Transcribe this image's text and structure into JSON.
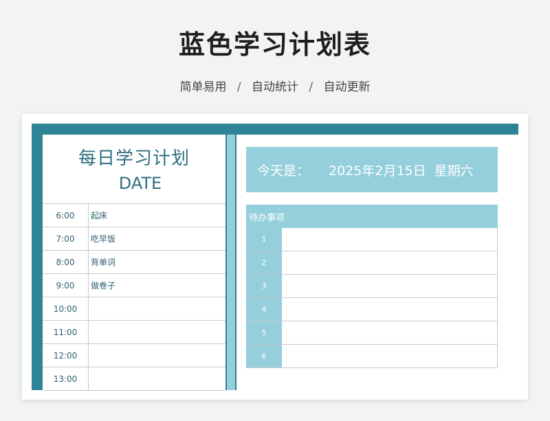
{
  "page": {
    "title": "蓝色学习计划表",
    "subtitle": [
      "简单易用",
      "自动统计",
      "自动更新"
    ],
    "separator": "/"
  },
  "left": {
    "title": "每日学习计划",
    "date_label": "DATE",
    "schedule": [
      {
        "time": "6:00",
        "task": "起床"
      },
      {
        "time": "7:00",
        "task": "吃早饭"
      },
      {
        "time": "8:00",
        "task": "背单词"
      },
      {
        "time": "9:00",
        "task": "做卷子"
      },
      {
        "time": "10:00",
        "task": ""
      },
      {
        "time": "11:00",
        "task": ""
      },
      {
        "time": "12:00",
        "task": ""
      },
      {
        "time": "13:00",
        "task": ""
      }
    ]
  },
  "right": {
    "today_label": "今天是：",
    "date": "2025年2月15日",
    "weekday": "星期六",
    "todo_header": "待办事项",
    "todos": [
      {
        "num": "1",
        "text": ""
      },
      {
        "num": "2",
        "text": ""
      },
      {
        "num": "3",
        "text": ""
      },
      {
        "num": "4",
        "text": ""
      },
      {
        "num": "5",
        "text": ""
      },
      {
        "num": "6",
        "text": ""
      }
    ]
  },
  "colors": {
    "frame": "#2f8396",
    "accent": "#94cfdb",
    "heading_text": "#2e6e80"
  }
}
